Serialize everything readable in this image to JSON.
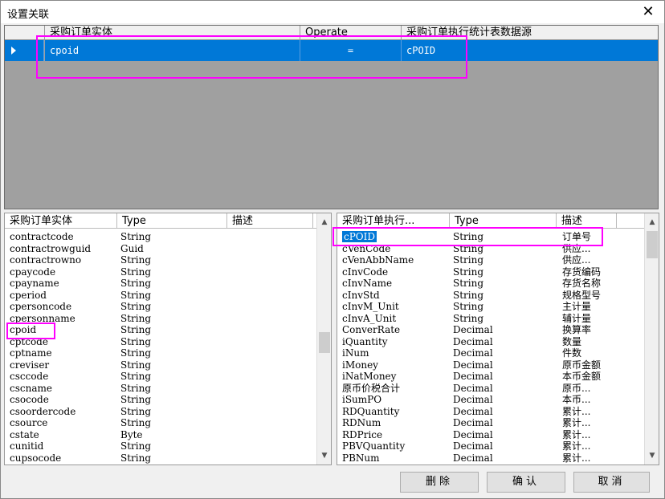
{
  "window": {
    "title": "设置关联",
    "close_glyph": "✕"
  },
  "relations": {
    "headers": [
      "采购订单实体",
      "Operate",
      "采购订单执行统计表数据源"
    ],
    "rows": [
      {
        "left": "cpoid",
        "op": "=",
        "right": "cPOID"
      }
    ]
  },
  "left_panel": {
    "headers": [
      "采购订单实体",
      "Type",
      "描述"
    ],
    "rows": [
      {
        "name": "contractcode",
        "type": "String",
        "desc": ""
      },
      {
        "name": "contractrowguid",
        "type": "Guid",
        "desc": ""
      },
      {
        "name": "contractrowno",
        "type": "String",
        "desc": ""
      },
      {
        "name": "cpaycode",
        "type": "String",
        "desc": ""
      },
      {
        "name": "cpayname",
        "type": "String",
        "desc": ""
      },
      {
        "name": "cperiod",
        "type": "String",
        "desc": ""
      },
      {
        "name": "cpersoncode",
        "type": "String",
        "desc": ""
      },
      {
        "name": "cpersonname",
        "type": "String",
        "desc": ""
      },
      {
        "name": "cpoid",
        "type": "String",
        "desc": ""
      },
      {
        "name": "cptcode",
        "type": "String",
        "desc": ""
      },
      {
        "name": "cptname",
        "type": "String",
        "desc": ""
      },
      {
        "name": "creviser",
        "type": "String",
        "desc": ""
      },
      {
        "name": "csccode",
        "type": "String",
        "desc": ""
      },
      {
        "name": "cscname",
        "type": "String",
        "desc": ""
      },
      {
        "name": "csocode",
        "type": "String",
        "desc": ""
      },
      {
        "name": "csoordercode",
        "type": "String",
        "desc": ""
      },
      {
        "name": "csource",
        "type": "String",
        "desc": ""
      },
      {
        "name": "cstate",
        "type": "Byte",
        "desc": ""
      },
      {
        "name": "cunitid",
        "type": "String",
        "desc": ""
      },
      {
        "name": "cupsocode",
        "type": "String",
        "desc": ""
      }
    ]
  },
  "right_panel": {
    "headers": [
      "采购订单执行...",
      "Type",
      "描述"
    ],
    "rows": [
      {
        "name": "cPOID",
        "type": "String",
        "desc": "订单号"
      },
      {
        "name": "cVenCode",
        "type": "String",
        "desc": "供应..."
      },
      {
        "name": "cVenAbbName",
        "type": "String",
        "desc": "供应..."
      },
      {
        "name": "cInvCode",
        "type": "String",
        "desc": "存货编码"
      },
      {
        "name": "cInvName",
        "type": "String",
        "desc": "存货名称"
      },
      {
        "name": "cInvStd",
        "type": "String",
        "desc": "规格型号"
      },
      {
        "name": "cInvM_Unit",
        "type": "String",
        "desc": "主计量"
      },
      {
        "name": "cInvA_Unit",
        "type": "String",
        "desc": "辅计量"
      },
      {
        "name": "ConverRate",
        "type": "Decimal",
        "desc": "换算率"
      },
      {
        "name": "iQuantity",
        "type": "Decimal",
        "desc": "数量"
      },
      {
        "name": "iNum",
        "type": "Decimal",
        "desc": "件数"
      },
      {
        "name": "iMoney",
        "type": "Decimal",
        "desc": "原币金额"
      },
      {
        "name": "iNatMoney",
        "type": "Decimal",
        "desc": "本币金额"
      },
      {
        "name": "原币价税合计",
        "type": "Decimal",
        "desc": "原币..."
      },
      {
        "name": "iSumPO",
        "type": "Decimal",
        "desc": "本币..."
      },
      {
        "name": "RDQuantity",
        "type": "Decimal",
        "desc": "累计..."
      },
      {
        "name": "RDNum",
        "type": "Decimal",
        "desc": "累计..."
      },
      {
        "name": "RDPrice",
        "type": "Decimal",
        "desc": "累计..."
      },
      {
        "name": "PBVQuantity",
        "type": "Decimal",
        "desc": "累计..."
      },
      {
        "name": "PBNum",
        "type": "Decimal",
        "desc": "累计..."
      }
    ]
  },
  "buttons": {
    "delete": "删除",
    "confirm": "确认",
    "cancel": "取消"
  },
  "colors": {
    "highlight": "#ff00ff",
    "selection": "#0078d7"
  }
}
